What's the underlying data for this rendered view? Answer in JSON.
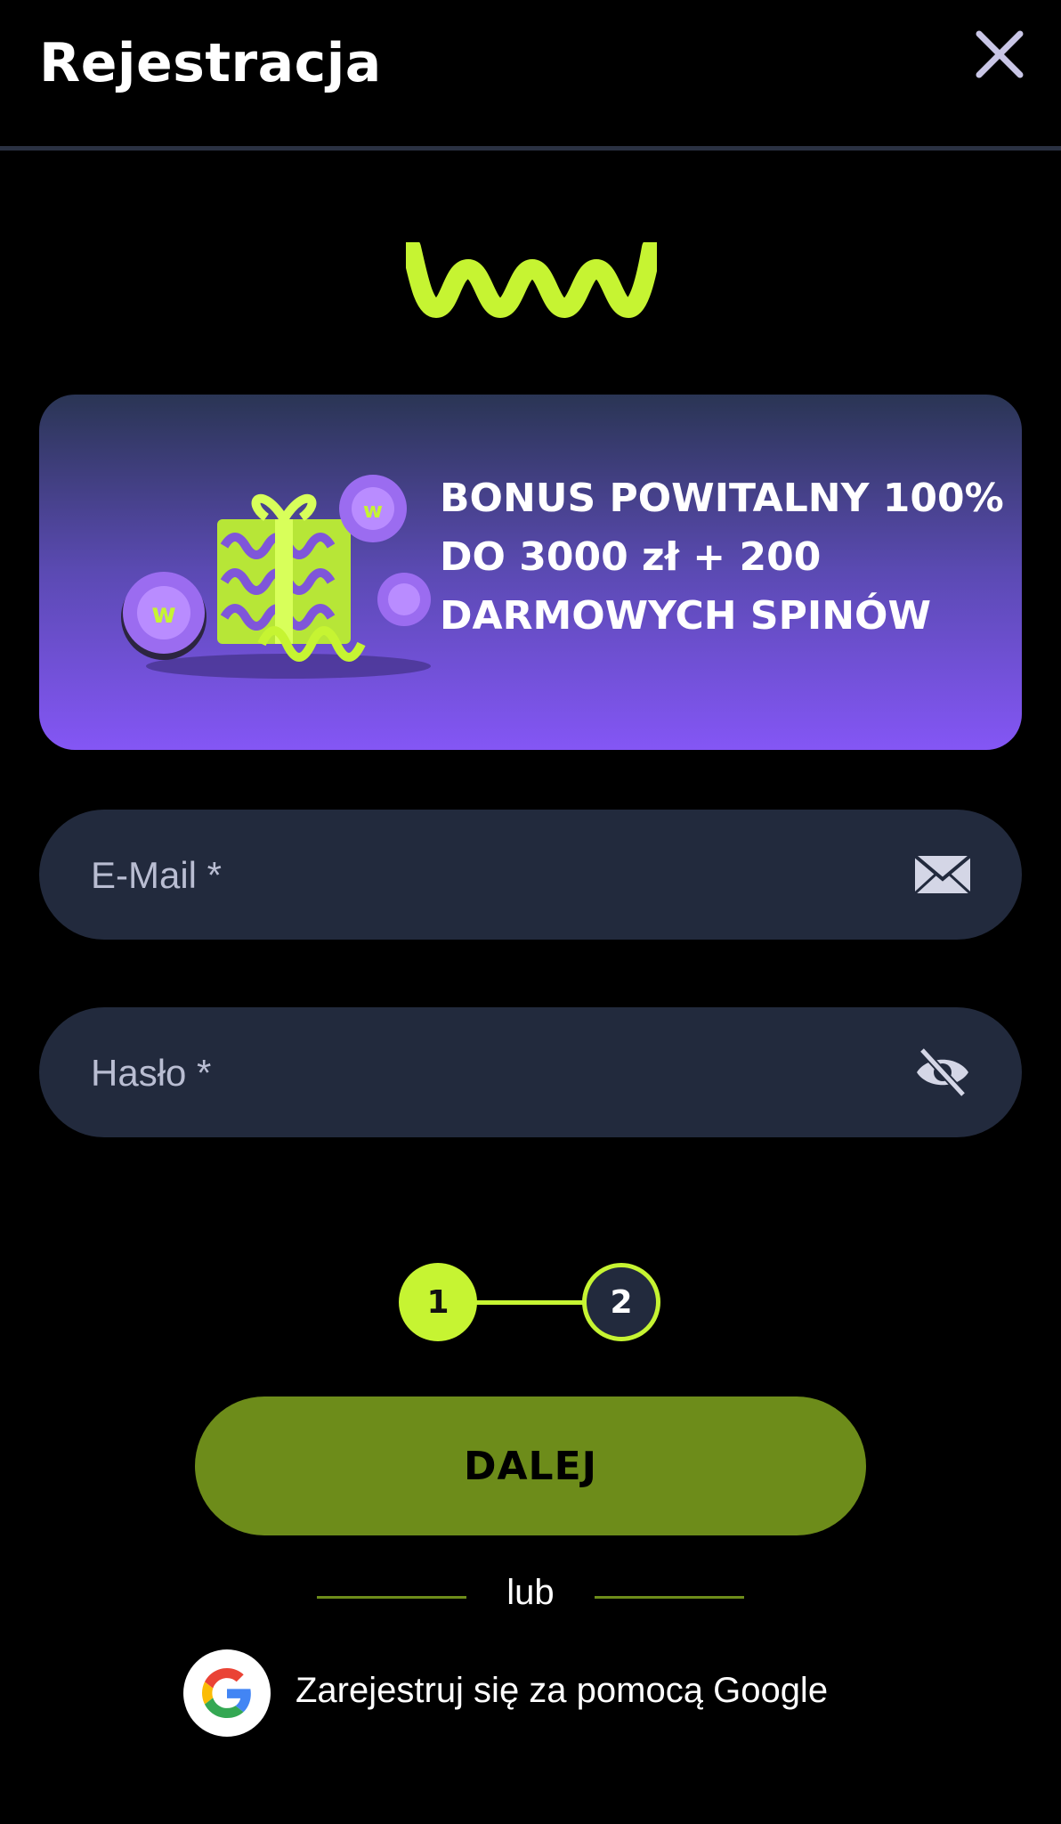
{
  "header": {
    "title": "Rejestracja",
    "close_icon": "close-icon"
  },
  "logo": {
    "text": "WW",
    "color": "#c6f432"
  },
  "banner": {
    "line1": "BONUS POWITALNY 100%",
    "line2": "DO 3000 zł + 200",
    "line3": "DARMOWYCH SPINÓW",
    "gradient_top": "#2a3554",
    "gradient_bottom": "#8456f5"
  },
  "form": {
    "email_placeholder": "E-Mail *",
    "email_value": "",
    "email_icon": "envelope-icon",
    "password_placeholder": "Hasło *",
    "password_value": "",
    "password_icon": "eye-off-icon"
  },
  "stepper": {
    "step1": "1",
    "step2": "2",
    "current_step": 1,
    "total_steps": 2
  },
  "actions": {
    "next_label": "DALEJ",
    "or_label": "lub",
    "google_label": "Zarejestruj się za pomocą Google",
    "google_icon": "google-icon"
  },
  "colors": {
    "accent": "#c6f432",
    "button": "#6d8c1a",
    "field_bg": "#222a3d",
    "background": "#000000"
  }
}
